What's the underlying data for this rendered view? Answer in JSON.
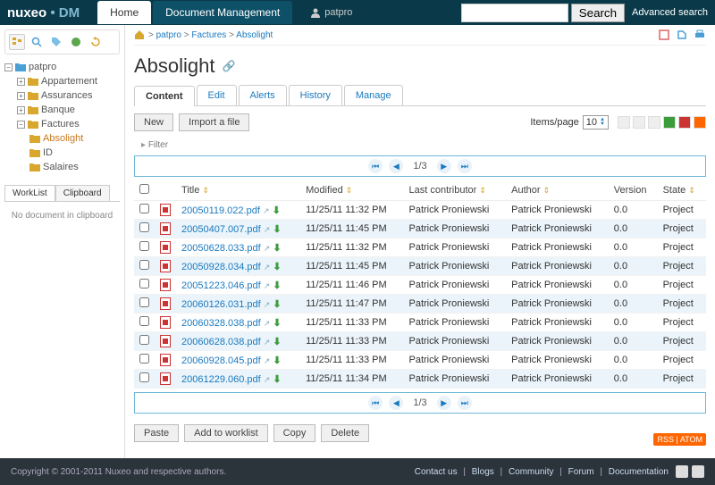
{
  "brand": {
    "name1": "nuxeo",
    "dot": "•",
    "name2": "DM"
  },
  "top_tabs": [
    {
      "label": "Home",
      "active": true
    },
    {
      "label": "Document Management",
      "active": false
    }
  ],
  "user": {
    "name": "patpro"
  },
  "search": {
    "placeholder": "",
    "button": "Search",
    "advanced": "Advanced search"
  },
  "tree": {
    "root": "patpro",
    "nodes": [
      {
        "label": "Appartement",
        "expandable": true
      },
      {
        "label": "Assurances",
        "expandable": true
      },
      {
        "label": "Banque",
        "expandable": true
      },
      {
        "label": "Factures",
        "expandable": true,
        "open": true,
        "children": [
          {
            "label": "Absolight",
            "selected": true
          },
          {
            "label": "ID"
          },
          {
            "label": "Salaires"
          }
        ]
      }
    ]
  },
  "sidebar_tabs": [
    {
      "label": "WorkList",
      "active": true
    },
    {
      "label": "Clipboard",
      "active": false
    }
  ],
  "clipboard_empty": "No document in clipboard",
  "breadcrumbs": [
    {
      "label": "patpro"
    },
    {
      "label": "Factures"
    },
    {
      "label": "Absolight"
    }
  ],
  "page_title": "Absolight",
  "content_tabs": [
    {
      "label": "Content",
      "active": true
    },
    {
      "label": "Edit"
    },
    {
      "label": "Alerts"
    },
    {
      "label": "History"
    },
    {
      "label": "Manage"
    }
  ],
  "buttons": {
    "new": "New",
    "import": "Import a file",
    "paste": "Paste",
    "addwl": "Add to worklist",
    "copy": "Copy",
    "delete": "Delete"
  },
  "items_per_page": {
    "label": "Items/page",
    "value": "10"
  },
  "filter": "Filter",
  "pagination": {
    "current": "1",
    "total": "3",
    "sep": "/"
  },
  "columns": {
    "title": "Title",
    "modified": "Modified",
    "lastcontrib": "Last contributor",
    "author": "Author",
    "version": "Version",
    "state": "State"
  },
  "rows": [
    {
      "title": "20050119.022.pdf",
      "modified": "11/25/11 11:32 PM",
      "lastcontrib": "Patrick Proniewski",
      "author": "Patrick Proniewski",
      "version": "0.0",
      "state": "Project"
    },
    {
      "title": "20050407.007.pdf",
      "modified": "11/25/11 11:45 PM",
      "lastcontrib": "Patrick Proniewski",
      "author": "Patrick Proniewski",
      "version": "0.0",
      "state": "Project"
    },
    {
      "title": "20050628.033.pdf",
      "modified": "11/25/11 11:32 PM",
      "lastcontrib": "Patrick Proniewski",
      "author": "Patrick Proniewski",
      "version": "0.0",
      "state": "Project"
    },
    {
      "title": "20050928.034.pdf",
      "modified": "11/25/11 11:45 PM",
      "lastcontrib": "Patrick Proniewski",
      "author": "Patrick Proniewski",
      "version": "0.0",
      "state": "Project"
    },
    {
      "title": "20051223.046.pdf",
      "modified": "11/25/11 11:46 PM",
      "lastcontrib": "Patrick Proniewski",
      "author": "Patrick Proniewski",
      "version": "0.0",
      "state": "Project"
    },
    {
      "title": "20060126.031.pdf",
      "modified": "11/25/11 11:47 PM",
      "lastcontrib": "Patrick Proniewski",
      "author": "Patrick Proniewski",
      "version": "0.0",
      "state": "Project"
    },
    {
      "title": "20060328.038.pdf",
      "modified": "11/25/11 11:33 PM",
      "lastcontrib": "Patrick Proniewski",
      "author": "Patrick Proniewski",
      "version": "0.0",
      "state": "Project"
    },
    {
      "title": "20060628.038.pdf",
      "modified": "11/25/11 11:33 PM",
      "lastcontrib": "Patrick Proniewski",
      "author": "Patrick Proniewski",
      "version": "0.0",
      "state": "Project"
    },
    {
      "title": "20060928.045.pdf",
      "modified": "11/25/11 11:33 PM",
      "lastcontrib": "Patrick Proniewski",
      "author": "Patrick Proniewski",
      "version": "0.0",
      "state": "Project"
    },
    {
      "title": "20061229.060.pdf",
      "modified": "11/25/11 11:34 PM",
      "lastcontrib": "Patrick Proniewski",
      "author": "Patrick Proniewski",
      "version": "0.0",
      "state": "Project"
    }
  ],
  "rss": {
    "rss": "RSS",
    "atom": "ATOM"
  },
  "footer": {
    "copyright": "Copyright © 2001-2011 Nuxeo and respective authors.",
    "links": [
      "Contact us",
      "Blogs",
      "Community",
      "Forum",
      "Documentation"
    ]
  }
}
